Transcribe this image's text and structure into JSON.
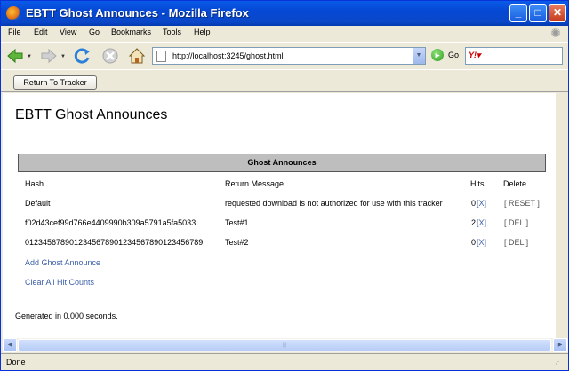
{
  "window": {
    "title": "EBTT Ghost Announces - Mozilla Firefox",
    "minimize_glyph": "_",
    "maximize_glyph": "□",
    "close_glyph": "✕"
  },
  "menu": [
    "File",
    "Edit",
    "View",
    "Go",
    "Bookmarks",
    "Tools",
    "Help"
  ],
  "navigation": {
    "url": "http://localhost:3245/ghost.html",
    "go_label": "Go"
  },
  "toolbar": {
    "return_button": "Return To Tracker"
  },
  "page": {
    "title": "EBTT Ghost Announces",
    "table_title": "Ghost Announces",
    "columns": [
      "Hash",
      "Return Message",
      "Hits",
      "Delete"
    ],
    "rows": [
      {
        "hash": "Default",
        "message": "requested download is not authorized for use with this tracker",
        "hits": "0",
        "hit_reset": "[X]",
        "delete": "[ RESET ]"
      },
      {
        "hash": "f02d43cef99d766e4409990b309a5791a5fa5033",
        "message": "Test#1",
        "hits": "2",
        "hit_reset": "[X]",
        "delete": "[ DEL ]"
      },
      {
        "hash": "0123456789012345678901234567890123456789",
        "message": "Test#2",
        "hits": "0",
        "hit_reset": "[X]",
        "delete": "[ DEL ]"
      }
    ],
    "add_link": "Add Ghost Announce",
    "clear_link": "Clear All Hit Counts",
    "footer": "Generated in 0.000 seconds."
  },
  "status": {
    "text": "Done"
  },
  "colors": {
    "titlebar": "#0A5BE8",
    "chrome": "#ECE9D8",
    "link": "#3B5FA8",
    "table_header": "#BEBEBE"
  },
  "icons": [
    "firefox-icon",
    "back-arrow-icon",
    "forward-arrow-icon",
    "reload-icon",
    "stop-icon",
    "home-icon",
    "page-icon",
    "go-icon",
    "search-engine-icon",
    "throbber-icon"
  ]
}
